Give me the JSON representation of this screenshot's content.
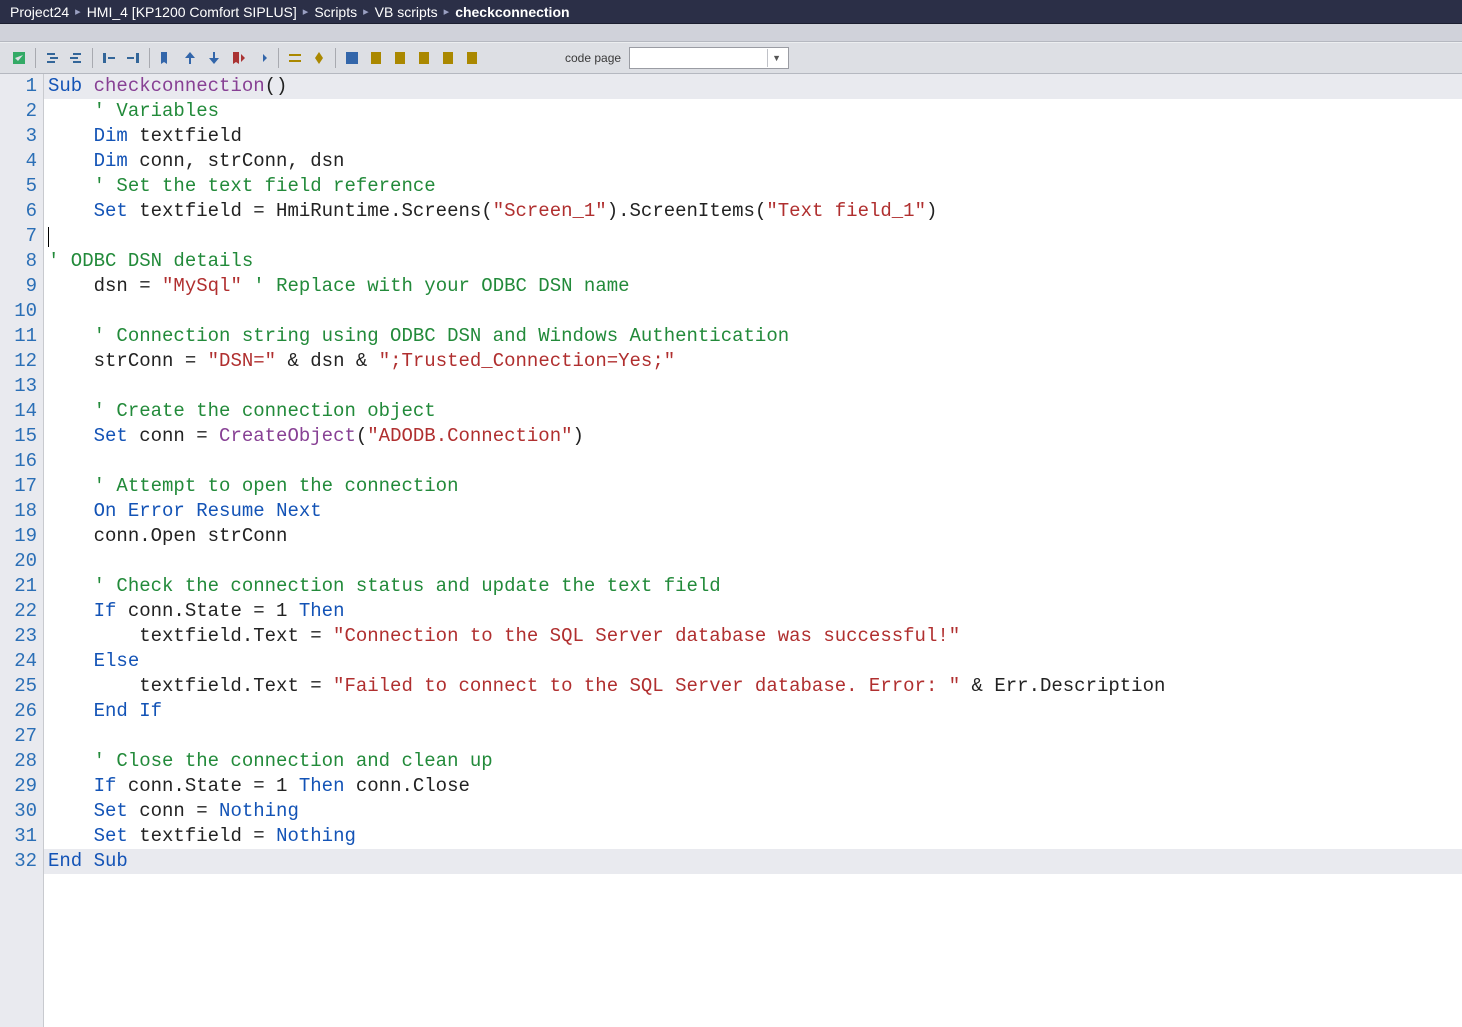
{
  "breadcrumb": {
    "items": [
      "Project24",
      "HMI_4 [KP1200 Comfort SIPLUS]",
      "Scripts",
      "VB scripts",
      "checkconnection"
    ]
  },
  "toolbar": {
    "codepage_label": "code page",
    "codepage_value": "",
    "buttons": [
      {
        "name": "check-icon"
      },
      {
        "name": "indent-right-icon"
      },
      {
        "name": "indent-left-icon"
      },
      {
        "name": "align-left-icon"
      },
      {
        "name": "align-right-icon"
      },
      {
        "name": "bookmark-icon"
      },
      {
        "name": "prev-bookmark-icon"
      },
      {
        "name": "next-bookmark-icon"
      },
      {
        "name": "clear-bookmarks-icon"
      },
      {
        "name": "go-to-icon"
      },
      {
        "name": "toggle-icon"
      },
      {
        "name": "insert-icon"
      },
      {
        "name": "object-browser-icon"
      },
      {
        "name": "script-1-icon"
      },
      {
        "name": "script-2-icon"
      },
      {
        "name": "script-3-icon"
      },
      {
        "name": "script-4-icon"
      },
      {
        "name": "script-5-icon"
      }
    ]
  },
  "code": {
    "lines": [
      {
        "n": 1,
        "tokens": [
          [
            "k",
            "Sub"
          ],
          [
            "n",
            " "
          ],
          [
            "fn",
            "checkconnection"
          ],
          [
            "n",
            "()"
          ]
        ],
        "hl": "first"
      },
      {
        "n": 2,
        "tokens": [
          [
            "n",
            "    "
          ],
          [
            "cm",
            "' Variables"
          ]
        ]
      },
      {
        "n": 3,
        "tokens": [
          [
            "n",
            "    "
          ],
          [
            "k",
            "Dim"
          ],
          [
            "n",
            " textfield"
          ]
        ]
      },
      {
        "n": 4,
        "tokens": [
          [
            "n",
            "    "
          ],
          [
            "k",
            "Dim"
          ],
          [
            "n",
            " conn, strConn, dsn"
          ]
        ]
      },
      {
        "n": 5,
        "tokens": [
          [
            "n",
            "    "
          ],
          [
            "cm",
            "' Set the text field reference"
          ]
        ]
      },
      {
        "n": 6,
        "tokens": [
          [
            "n",
            "    "
          ],
          [
            "k",
            "Set"
          ],
          [
            "n",
            " textfield = HmiRuntime.Screens("
          ],
          [
            "s",
            "\"Screen_1\""
          ],
          [
            "n",
            ").ScreenItems("
          ],
          [
            "s",
            "\"Text field_1\""
          ],
          [
            "n",
            ")"
          ]
        ]
      },
      {
        "n": 7,
        "tokens": [
          [
            "n",
            ""
          ]
        ],
        "caret": true
      },
      {
        "n": 8,
        "tokens": [
          [
            "cm",
            "' ODBC DSN details"
          ]
        ]
      },
      {
        "n": 9,
        "tokens": [
          [
            "n",
            "    dsn = "
          ],
          [
            "s",
            "\"MySql\""
          ],
          [
            "n",
            " "
          ],
          [
            "cm",
            "' Replace with your ODBC DSN name"
          ]
        ]
      },
      {
        "n": 10,
        "tokens": [
          [
            "n",
            ""
          ]
        ]
      },
      {
        "n": 11,
        "tokens": [
          [
            "n",
            "    "
          ],
          [
            "cm",
            "' Connection string using ODBC DSN and Windows Authentication"
          ]
        ]
      },
      {
        "n": 12,
        "tokens": [
          [
            "n",
            "    strConn = "
          ],
          [
            "s",
            "\"DSN=\""
          ],
          [
            "n",
            " & dsn & "
          ],
          [
            "s",
            "\";Trusted_Connection=Yes;\""
          ]
        ]
      },
      {
        "n": 13,
        "tokens": [
          [
            "n",
            ""
          ]
        ]
      },
      {
        "n": 14,
        "tokens": [
          [
            "n",
            "    "
          ],
          [
            "cm",
            "' Create the connection object"
          ]
        ]
      },
      {
        "n": 15,
        "tokens": [
          [
            "n",
            "    "
          ],
          [
            "k",
            "Set"
          ],
          [
            "n",
            " conn = "
          ],
          [
            "fn",
            "CreateObject"
          ],
          [
            "n",
            "("
          ],
          [
            "s",
            "\"ADODB.Connection\""
          ],
          [
            "n",
            ")"
          ]
        ]
      },
      {
        "n": 16,
        "tokens": [
          [
            "n",
            ""
          ]
        ]
      },
      {
        "n": 17,
        "tokens": [
          [
            "n",
            "    "
          ],
          [
            "cm",
            "' Attempt to open the connection"
          ]
        ]
      },
      {
        "n": 18,
        "tokens": [
          [
            "n",
            "    "
          ],
          [
            "k",
            "On"
          ],
          [
            "n",
            " "
          ],
          [
            "k",
            "Error"
          ],
          [
            "n",
            " "
          ],
          [
            "k",
            "Resume"
          ],
          [
            "n",
            " "
          ],
          [
            "k",
            "Next"
          ]
        ]
      },
      {
        "n": 19,
        "tokens": [
          [
            "n",
            "    conn.Open strConn"
          ]
        ]
      },
      {
        "n": 20,
        "tokens": [
          [
            "n",
            ""
          ]
        ]
      },
      {
        "n": 21,
        "tokens": [
          [
            "n",
            "    "
          ],
          [
            "cm",
            "' Check the connection status and update the text field"
          ]
        ]
      },
      {
        "n": 22,
        "tokens": [
          [
            "n",
            "    "
          ],
          [
            "k",
            "If"
          ],
          [
            "n",
            " conn.State = 1 "
          ],
          [
            "k",
            "Then"
          ]
        ]
      },
      {
        "n": 23,
        "tokens": [
          [
            "n",
            "        textfield.Text = "
          ],
          [
            "s",
            "\"Connection to the SQL Server database was successful!\""
          ]
        ]
      },
      {
        "n": 24,
        "tokens": [
          [
            "n",
            "    "
          ],
          [
            "k",
            "Else"
          ]
        ]
      },
      {
        "n": 25,
        "tokens": [
          [
            "n",
            "        textfield.Text = "
          ],
          [
            "s",
            "\"Failed to connect to the SQL Server database. Error: \""
          ],
          [
            "n",
            " & Err.Description"
          ]
        ]
      },
      {
        "n": 26,
        "tokens": [
          [
            "n",
            "    "
          ],
          [
            "k",
            "End"
          ],
          [
            "n",
            " "
          ],
          [
            "k",
            "If"
          ]
        ]
      },
      {
        "n": 27,
        "tokens": [
          [
            "n",
            ""
          ]
        ]
      },
      {
        "n": 28,
        "tokens": [
          [
            "n",
            "    "
          ],
          [
            "cm",
            "' Close the connection and clean up"
          ]
        ]
      },
      {
        "n": 29,
        "tokens": [
          [
            "n",
            "    "
          ],
          [
            "k",
            "If"
          ],
          [
            "n",
            " conn.State = 1 "
          ],
          [
            "k",
            "Then"
          ],
          [
            "n",
            " conn.Close"
          ]
        ]
      },
      {
        "n": 30,
        "tokens": [
          [
            "n",
            "    "
          ],
          [
            "k",
            "Set"
          ],
          [
            "n",
            " conn = "
          ],
          [
            "k",
            "Nothing"
          ]
        ]
      },
      {
        "n": 31,
        "tokens": [
          [
            "n",
            "    "
          ],
          [
            "k",
            "Set"
          ],
          [
            "n",
            " textfield = "
          ],
          [
            "k",
            "Nothing"
          ]
        ]
      },
      {
        "n": 32,
        "tokens": [
          [
            "k",
            "End"
          ],
          [
            "n",
            " "
          ],
          [
            "k",
            "Sub"
          ]
        ],
        "hl": "last"
      }
    ]
  },
  "colors": {
    "breadcrumb_bg": "#2b2f47",
    "toolbar_bg": "#dddfe4",
    "gutter_bg": "#e9eaef",
    "keyword": "#1353b6",
    "function": "#874094",
    "comment": "#228a3a",
    "string": "#b02f2f"
  }
}
